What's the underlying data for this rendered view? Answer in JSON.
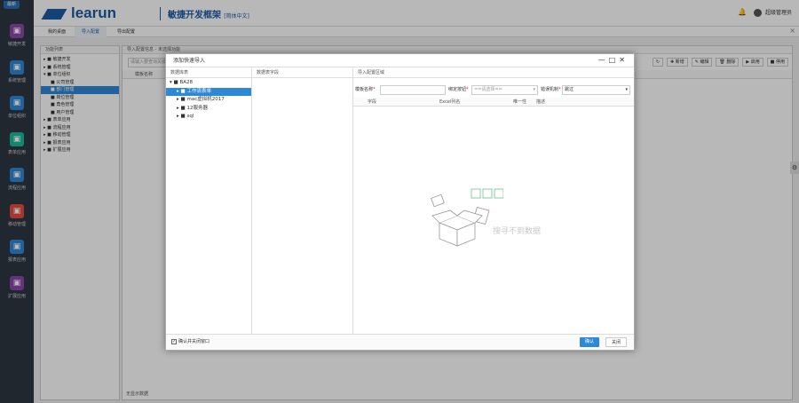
{
  "leftbar": {
    "badge": "最新",
    "items": [
      {
        "label": "敏捷开发",
        "icon": "paper-plane-icon",
        "color": "#8e44ad"
      },
      {
        "label": "系统管理",
        "icon": "monitor-icon",
        "color": "#2e88d8"
      },
      {
        "label": "单位组织",
        "icon": "id-card-icon",
        "color": "#2e88d8"
      },
      {
        "label": "表单应用",
        "icon": "table-icon",
        "color": "#1abc9c"
      },
      {
        "label": "流程应用",
        "icon": "share-icon",
        "color": "#2e88d8"
      },
      {
        "label": "移动管理",
        "icon": "android-icon",
        "color": "#e74c3c"
      },
      {
        "label": "报表应用",
        "icon": "chart-icon",
        "color": "#2e88d8"
      },
      {
        "label": "扩展应用",
        "icon": "globe-icon",
        "color": "#8e44ad"
      }
    ]
  },
  "header": {
    "brand": "learun",
    "subtitle": "敏捷开发框架",
    "lang": "[简体中文]",
    "user": "超级管理员"
  },
  "tabs": [
    "我的桌面",
    "导入配置",
    "导出配置"
  ],
  "module_tree": {
    "title": "功能列表",
    "items": [
      {
        "label": "敏捷开发",
        "level": 0,
        "icon": "send-icon"
      },
      {
        "label": "系统管理",
        "level": 0,
        "icon": "monitor-icon"
      },
      {
        "label": "单位组织",
        "level": 0,
        "icon": "id-card-icon"
      },
      {
        "label": "公司管理",
        "level": 1,
        "icon": "sitemap-icon"
      },
      {
        "label": "部门管理",
        "level": 1,
        "icon": "flag-icon",
        "selected": true
      },
      {
        "label": "岗位管理",
        "level": 1,
        "icon": "users-icon"
      },
      {
        "label": "角色管理",
        "level": 1,
        "icon": "user-icon"
      },
      {
        "label": "用户管理",
        "level": 1,
        "icon": "user-icon"
      },
      {
        "label": "表单应用",
        "level": 0,
        "icon": "table-icon"
      },
      {
        "label": "流程应用",
        "level": 0,
        "icon": "share-icon"
      },
      {
        "label": "移动管理",
        "level": 0,
        "icon": "mobile-icon"
      },
      {
        "label": "报表应用",
        "level": 0,
        "icon": "chart-icon"
      },
      {
        "label": "扩展应用",
        "level": 0,
        "icon": "globe-icon"
      }
    ]
  },
  "main": {
    "title": "导入配置信息 - 未选择功能",
    "search_placeholder": "请输入要查询关键字",
    "toolbar": [
      "新增",
      "编辑",
      "删除",
      "启用",
      "停用"
    ],
    "grid_header": "模板名称",
    "footer": "无显示数据"
  },
  "dialog": {
    "title": "添加快速导入",
    "col_db": "数据库表",
    "col_fields": "数据表字段",
    "col_config": "导入配置区域",
    "db_tree": [
      {
        "label": "BA28",
        "level": 0,
        "open": true
      },
      {
        "label": "工作流表单",
        "level": 1,
        "selected": true
      },
      {
        "label": "mac虚拟机2017",
        "level": 1
      },
      {
        "label": "12服务器",
        "level": 1
      },
      {
        "label": "sql",
        "level": 1
      }
    ],
    "form": {
      "name_label": "模板名称",
      "bind_label": "绑定按钮",
      "bind_placeholder": "==请选择==",
      "error_label": "错误机制",
      "error_value": "跳过"
    },
    "grid_cols": [
      "字段",
      "Excel列名",
      "唯一性",
      "描述"
    ],
    "empty_text": "搜寻不到数据",
    "close_checkbox": "确认并关闭窗口",
    "ok": "确认",
    "cancel": "关闭"
  }
}
